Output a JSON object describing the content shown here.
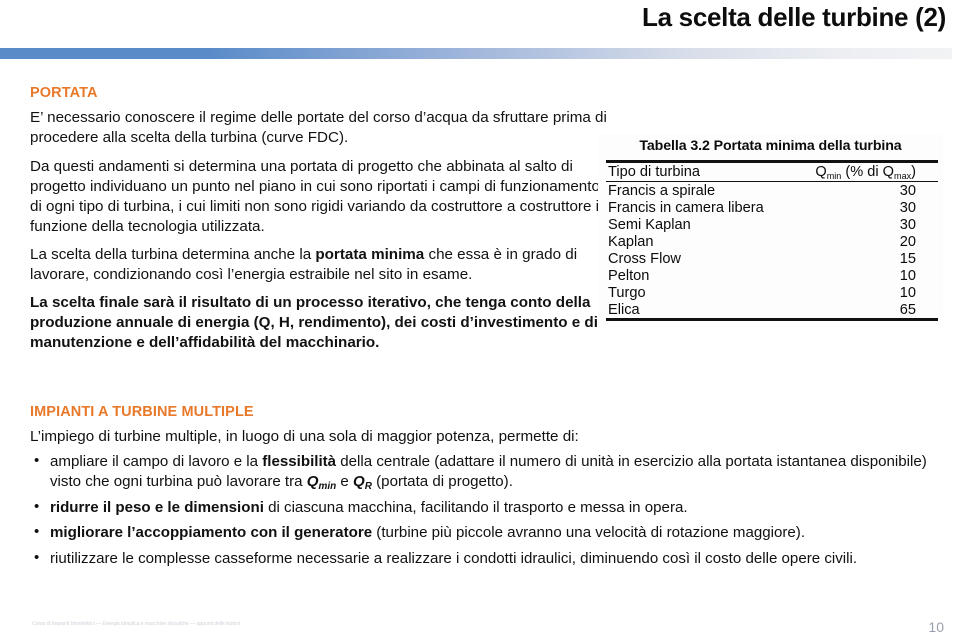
{
  "slide": {
    "title": "La scelta delle turbine (2)",
    "page_number": "10",
    "footer_note": "Corso di Impianti Idroelettrici — Energia idraulica e macchine idrauliche — appunti delle lezioni",
    "accent_orange": "#E8792B",
    "accent_blue": "#5A8BC9"
  },
  "left": {
    "heading": "PORTATA",
    "paragraphs": [
      {
        "bold": false,
        "text": "E’ necessario conoscere il regime delle portate del corso d’acqua da sfruttare prima di procedere alla scelta della turbina (curve FDC)."
      },
      {
        "bold": false,
        "text": "Da questi andamenti si determina una portata di progetto che abbinata al salto di progetto individuano un punto nel piano in cui sono riportati i campi di funzionamento di ogni tipo di turbina, i cui limiti non sono rigidi variando da costruttore a costruttore in funzione della tecnologia utilizzata."
      },
      {
        "bold": false,
        "prefix": "La scelta della turbina determina anche la ",
        "strong": "portata minima",
        "suffix": " che essa è in grado di lavorare, condizionando così l’energia estraibile nel sito in esame."
      },
      {
        "bold": true,
        "text": "La scelta finale sarà il risultato di un processo iterativo, che tenga conto della produzione annuale di energia (Q, H, rendimento), dei costi d’investimento e di manutenzione e dell’affidabilità del macchinario."
      }
    ]
  },
  "table_figure": {
    "caption": "Tabella 3.2 Portata minima della turbina",
    "columns": {
      "type": "Tipo di turbina",
      "value_pre": "Q",
      "value_sub1": "min",
      "value_mid": " (% di Q",
      "value_sub2": "max",
      "value_post": ")"
    },
    "rows": [
      {
        "type": "Francis a spirale",
        "value": "30"
      },
      {
        "type": "Francis in camera libera",
        "value": "30"
      },
      {
        "type": "Semi Kaplan",
        "value": "30"
      },
      {
        "type": "Kaplan",
        "value": "20"
      },
      {
        "type": "Cross Flow",
        "value": "15"
      },
      {
        "type": "Pelton",
        "value": "10"
      },
      {
        "type": "Turgo",
        "value": "10"
      },
      {
        "type": "Elica",
        "value": "65"
      }
    ]
  },
  "bottom": {
    "heading": "IMPIANTI A TURBINE MULTIPLE",
    "lead": "L’impiego di turbine multiple, in luogo di una sola di maggior potenza, permette di:",
    "bullet_marker": "•",
    "bullets": [
      {
        "pre": "ampliare il campo di lavoro e la ",
        "strong": "flessibilità",
        "mid": " della centrale (adattare il numero di unità in esercizio alla portata istantanea disponibile) visto che ogni turbina può lavorare tra ",
        "sym1": "Q",
        "sym1_sub": "min",
        "mid2": " e ",
        "sym2": "Q",
        "sym2_sub": "R",
        "post": " (portata di progetto)."
      },
      {
        "strong": "ridurre il peso e le dimensioni",
        "post": " di ciascuna macchina, facilitando il trasporto e messa in opera."
      },
      {
        "strong": "migliorare l’accoppiamento con il generatore",
        "post": " (turbine più piccole avranno una velocità di rotazione maggiore)."
      },
      {
        "strong": "",
        "post": "riutilizzare le complesse casseforme necessarie a realizzare i condotti idraulici, diminuendo così il costo delle opere civili."
      }
    ]
  }
}
